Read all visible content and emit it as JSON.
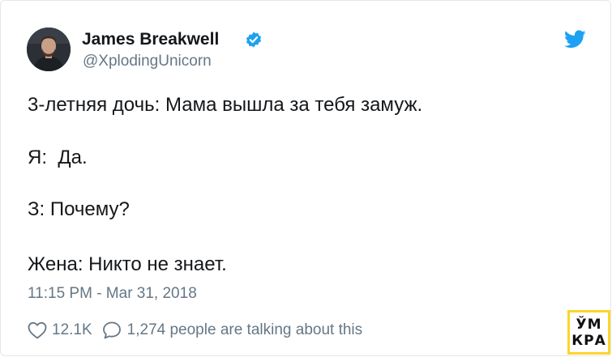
{
  "author": {
    "display_name": "James Breakwell",
    "handle": "@XplodingUnicorn",
    "verified": true
  },
  "tweet": {
    "lines": [
      "3-летняя дочь: Мама вышла за тебя замуж.",
      "Я:  Да.",
      "З: Почему?",
      "Жена: Никто не знает."
    ],
    "timestamp": "11:15 PM - Mar 31, 2018"
  },
  "actions": {
    "like_count": "12.1K",
    "talking_text": "1,274 people are talking about this"
  },
  "watermark": {
    "top": "ЎМ",
    "bottom": "КРА"
  },
  "icons": {
    "twitter_bird": "twitter-bird-icon",
    "verified": "verified-badge-icon",
    "like": "heart-icon",
    "reply": "speech-bubble-icon"
  },
  "colors": {
    "twitter_blue": "#1da1f2",
    "secondary_text": "#657786",
    "primary_text": "#14171a",
    "logo_yellow": "#fcd52b"
  }
}
